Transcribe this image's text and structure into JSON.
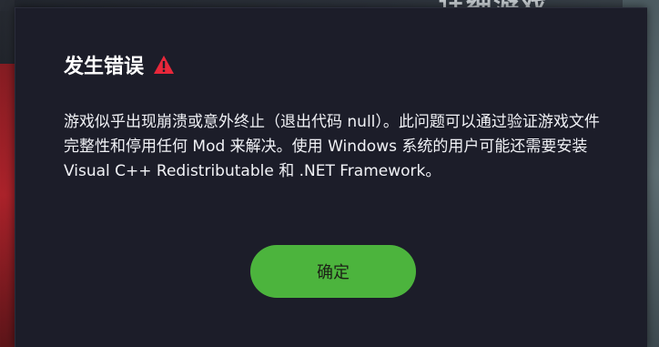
{
  "background": {
    "top_text": "详细游戏"
  },
  "dialog": {
    "title": "发生错误",
    "title_icon": "warning-triangle-icon",
    "message": "游戏似乎出现崩溃或意外终止（退出代码 null）。此问题可以通过验证游戏文件完整性和停用任何 Mod 来解决。使用 Windows 系统的用户可能还需要安装 Visual C++ Redistributable 和 .NET Framework。",
    "ok_label": "确定"
  },
  "colors": {
    "dialog_bg": "#1c1d29",
    "warning_red": "#e8273a",
    "ok_green": "#4cb43d"
  }
}
